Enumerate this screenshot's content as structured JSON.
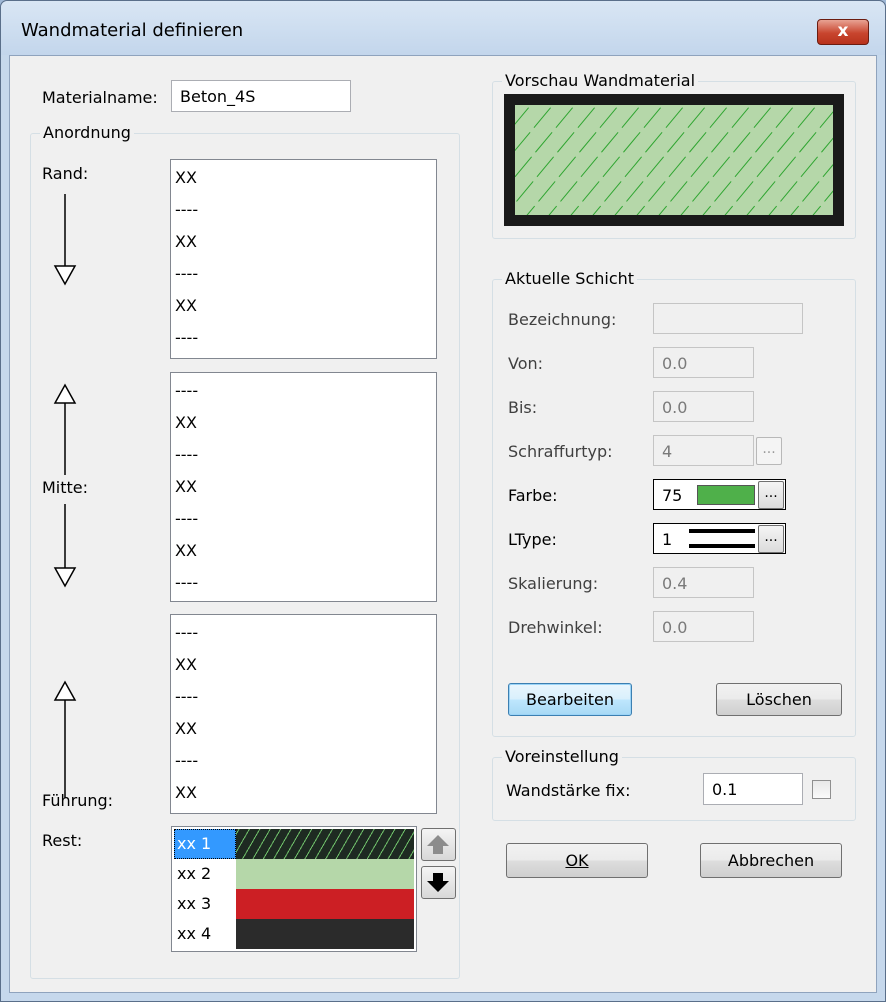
{
  "window": {
    "title": "Wandmaterial definieren",
    "close_glyph": "x"
  },
  "material": {
    "label": "Materialname:",
    "value": "Beton_4S"
  },
  "arrangement": {
    "title": "Anordnung",
    "rand_label": "Rand:",
    "mitte_label": "Mitte:",
    "fuehrung_label": "Führung:",
    "rest_label": "Rest:",
    "list1": [
      "XX",
      "----",
      "XX",
      "----",
      "XX",
      "----"
    ],
    "list2": [
      "----",
      "XX",
      "----",
      "XX",
      "----",
      "XX",
      "----"
    ],
    "list3": [
      "----",
      "XX",
      "----",
      "XX",
      "----",
      "XX"
    ],
    "rest": [
      {
        "label": "xx 1",
        "color": "#1e2a22",
        "selected": true
      },
      {
        "label": "xx 2",
        "color": "#b5d7a9"
      },
      {
        "label": "xx 3",
        "color": "#cc1f24"
      },
      {
        "label": "xx 4",
        "color": "#2b2b2b"
      }
    ]
  },
  "preview": {
    "title": "Vorschau Wandmaterial",
    "fill_color": "#b5d7a9",
    "hatch_color": "#2fa531",
    "frame_color": "#1a1a1a"
  },
  "layer": {
    "title": "Aktuelle Schicht",
    "bezeichnung_label": "Bezeichnung:",
    "bezeichnung_value": "",
    "von_label": "Von:",
    "von_value": "0.0",
    "bis_label": "Bis:",
    "bis_value": "0.0",
    "schraffur_label": "Schraffurtyp:",
    "schraffur_value": "4",
    "farbe_label": "Farbe:",
    "farbe_value": "75",
    "farbe_color": "#4fb04a",
    "ltype_label": "LType:",
    "ltype_value": "1",
    "skalierung_label": "Skalierung:",
    "skalierung_value": "0.4",
    "drehwinkel_label": "Drehwinkel:",
    "drehwinkel_value": "0.0",
    "ellipsis": "...",
    "edit_button": "Bearbeiten",
    "delete_button": "Löschen"
  },
  "preset": {
    "title": "Voreinstellung",
    "label": "Wandstärke fix:",
    "value": "0.1",
    "checked": false
  },
  "buttons": {
    "ok": "OK",
    "cancel": "Abbrechen"
  }
}
